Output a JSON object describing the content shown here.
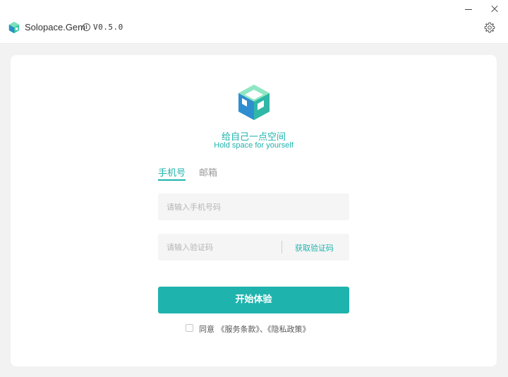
{
  "app": {
    "name": "Solopace.Gem",
    "info_glyph": "i",
    "version": "V0.5.0",
    "brand_color": "#1fb3ad",
    "icons": [
      "cube-logo-icon",
      "info-icon",
      "minimize-icon",
      "close-icon",
      "gear-icon"
    ]
  },
  "hero": {
    "slogan_cn": "给自己一点空间",
    "slogan_en": "Hold space for yourself"
  },
  "tabs": [
    {
      "label": "手机号",
      "active": true
    },
    {
      "label": "邮箱",
      "active": false
    }
  ],
  "form": {
    "phone": {
      "value": "",
      "placeholder": "请输入手机号码"
    },
    "code": {
      "value": "",
      "placeholder": "请输入验证码"
    },
    "get_code_label": "获取验证码",
    "submit_label": "开始体验"
  },
  "agreement": {
    "checked": false,
    "prefix": "同意 ",
    "terms": "《服务条款》",
    "separator": "、",
    "privacy": "《隐私政策》"
  }
}
